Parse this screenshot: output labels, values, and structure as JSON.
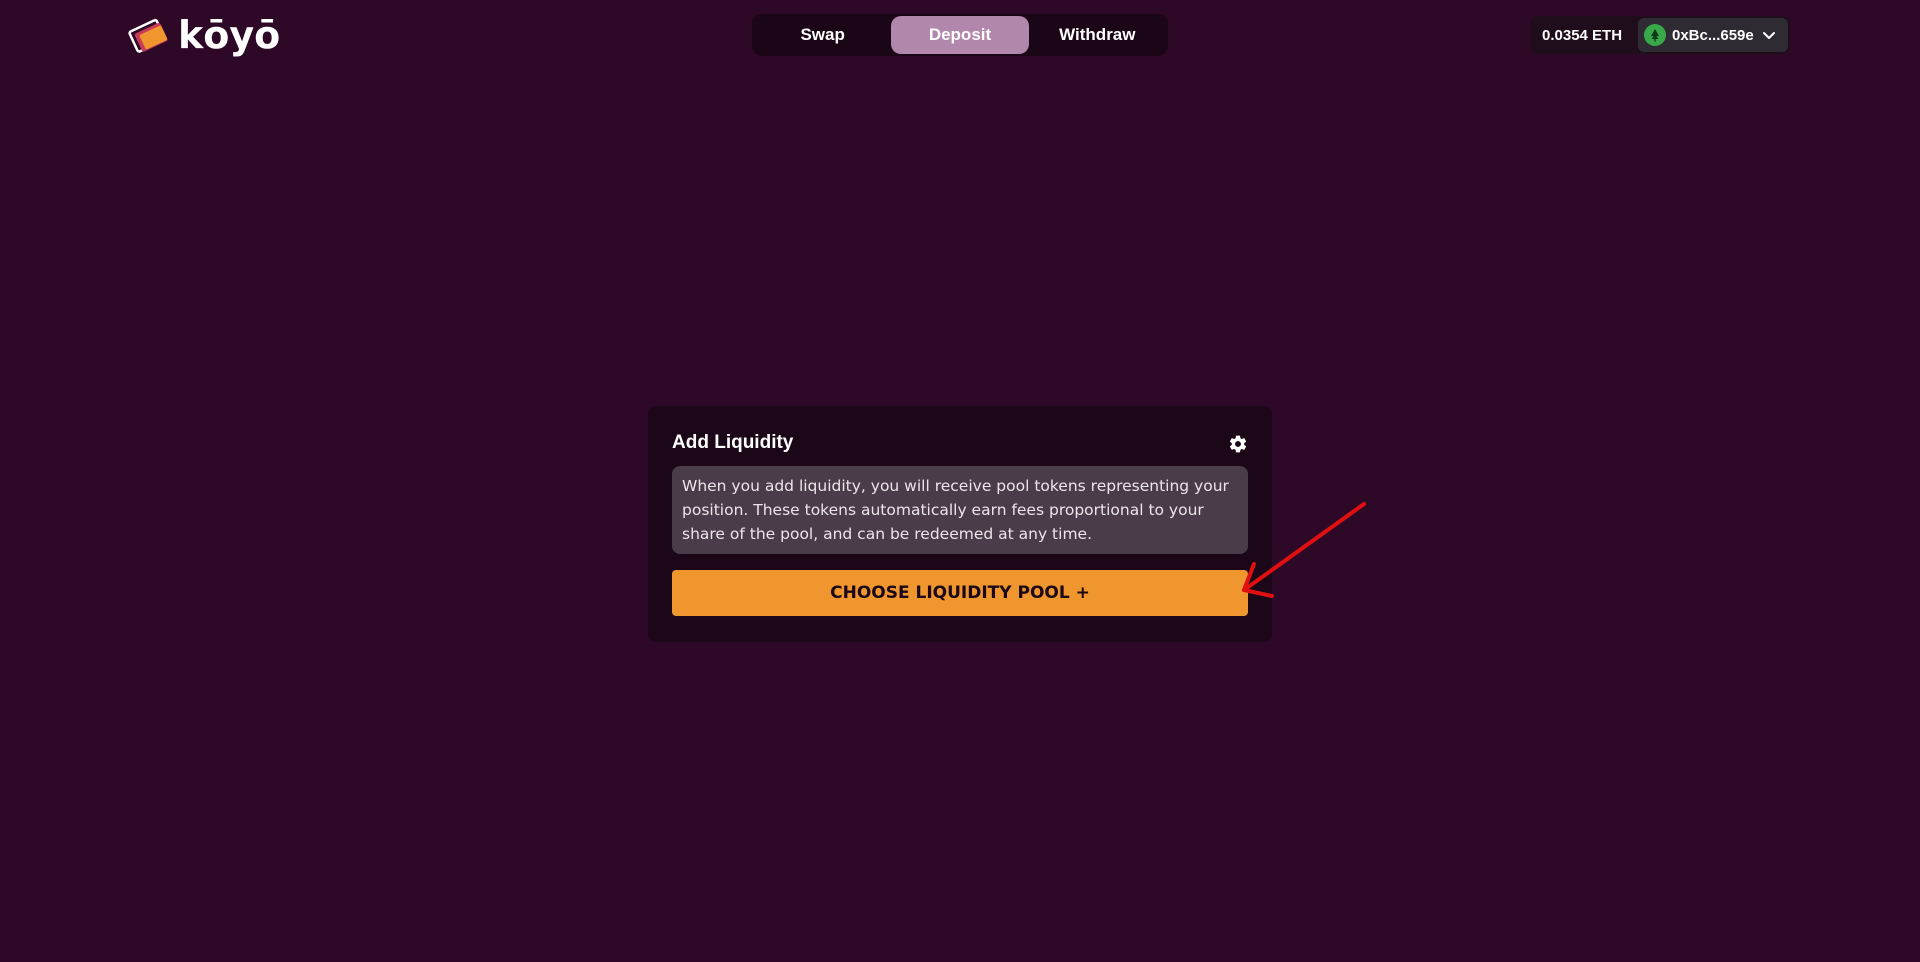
{
  "brand": {
    "name": "kōyō"
  },
  "nav": {
    "tabs": [
      {
        "label": "Swap",
        "active": false
      },
      {
        "label": "Deposit",
        "active": true
      },
      {
        "label": "Withdraw",
        "active": false
      }
    ]
  },
  "wallet": {
    "balance": "0.0354 ETH",
    "address": "0xBc...659e",
    "avatar_icon": "tree-icon"
  },
  "card": {
    "title": "Add Liquidity",
    "settings_icon": "gear-icon",
    "info": "When you add liquidity, you will receive pool tokens representing your position. These tokens automatically earn fees proportional to your share of the pool, and can be redeemed at any time.",
    "button_label": "CHOOSE LIQUIDITY POOL +"
  },
  "colors": {
    "background": "#2e0827",
    "card": "#1b0718",
    "active_tab": "#b188ac",
    "accent": "#f0962e",
    "annotation": "#e01010"
  }
}
